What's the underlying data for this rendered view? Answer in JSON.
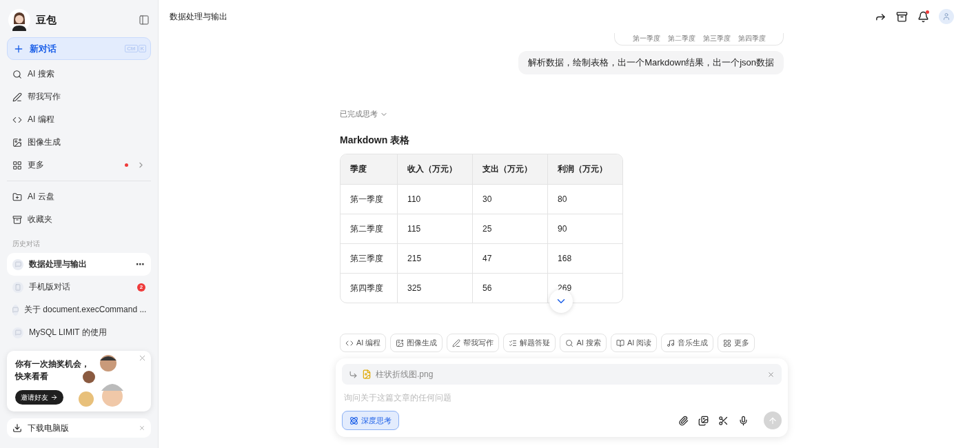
{
  "sidebar": {
    "app_name": "豆包",
    "new_chat": {
      "label": "新对话",
      "shortcut": [
        "Ctrl",
        "K"
      ]
    },
    "menu": [
      {
        "kind": "search",
        "label": "AI 搜索",
        "badge": false
      },
      {
        "kind": "write",
        "label": "帮我写作",
        "badge": false
      },
      {
        "kind": "code",
        "label": "AI 编程",
        "badge": false
      },
      {
        "kind": "image",
        "label": "图像生成",
        "badge": false
      },
      {
        "kind": "more",
        "label": "更多",
        "badge": true
      }
    ],
    "tools": [
      {
        "kind": "cloud",
        "label": "AI 云盘"
      },
      {
        "kind": "favorites",
        "label": "收藏夹"
      }
    ],
    "history_label": "历史对话",
    "history": [
      {
        "kind": "chat",
        "title": "数据处理与输出",
        "selected": true,
        "options": "⋯"
      },
      {
        "kind": "phone",
        "title": "手机版对话",
        "selected": false,
        "count": "2"
      },
      {
        "kind": "chat",
        "title": "关于 document.execCommand ...",
        "selected": false
      },
      {
        "kind": "chat",
        "title": "MySQL LIMIT 的使用",
        "selected": false
      }
    ],
    "promo": {
      "lines": [
        "你有一次抽奖机会，",
        "快来看看"
      ],
      "button": "邀请好友"
    },
    "download": "下载电脑版"
  },
  "header": {
    "title": "数据处理与输出",
    "notification": true
  },
  "chat": {
    "image_labels": [
      "第一季度",
      "第二季度",
      "第三季度",
      "第四季度"
    ],
    "user_message": "解析数据，绘制表格，出一个Markdown结果，出一个json数据",
    "thinking": "已完成思考",
    "heading": "Markdown 表格",
    "table": {
      "columns": [
        "季度",
        "收入（万元）",
        "支出（万元）",
        "利润（万元）"
      ],
      "rows": [
        [
          "第一季度",
          "110",
          "30",
          "80"
        ],
        [
          "第二季度",
          "115",
          "25",
          "90"
        ],
        [
          "第三季度",
          "215",
          "47",
          "168"
        ],
        [
          "第四季度",
          "325",
          "56",
          "269"
        ]
      ]
    }
  },
  "composer": {
    "chips": [
      {
        "kind": "code",
        "label": "AI 编程"
      },
      {
        "kind": "image",
        "label": "图像生成"
      },
      {
        "kind": "write",
        "label": "帮我写作"
      },
      {
        "kind": "solve",
        "label": "解题答疑"
      },
      {
        "kind": "search",
        "label": "AI 搜索"
      },
      {
        "kind": "read",
        "label": "AI 阅读"
      },
      {
        "kind": "music",
        "label": "音乐生成"
      },
      {
        "kind": "more",
        "label": "更多"
      }
    ],
    "attachment": "柱状折线图.png",
    "placeholder": "询问关于这篇文章的任何问题",
    "deep_think": {
      "label": "深度思考",
      "on": true
    }
  }
}
